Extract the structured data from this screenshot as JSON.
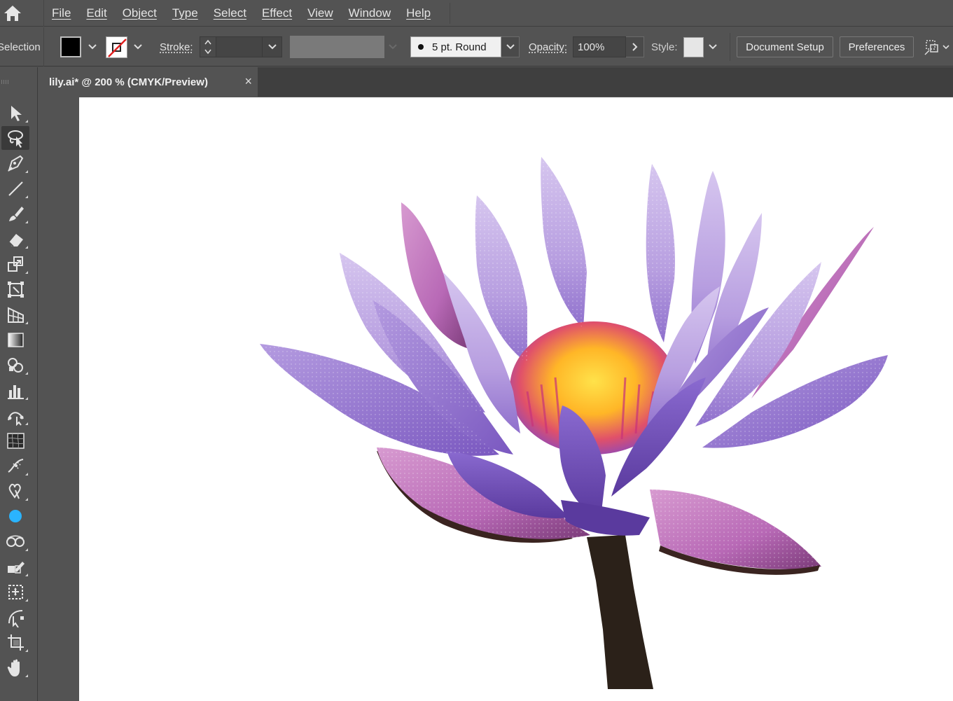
{
  "menu": {
    "items": [
      "File",
      "Edit",
      "Object",
      "Type",
      "Select",
      "Effect",
      "View",
      "Window",
      "Help"
    ]
  },
  "control_bar": {
    "mode_label": "Selection",
    "fill_color": "#000000",
    "stroke_label": "Stroke:",
    "brush_label": "5 pt. Round",
    "opacity_label": "Opacity:",
    "opacity_value": "100%",
    "style_label": "Style:",
    "document_setup": "Document Setup",
    "preferences": "Preferences"
  },
  "document_tab": {
    "title": "lily.ai* @ 200 % (CMYK/Preview)",
    "close": "×"
  },
  "toolbar": {
    "tools": [
      "selection-tool-icon",
      "lasso-tool-icon",
      "pen-tool-icon",
      "line-tool-icon",
      "paintbrush-tool-icon",
      "eraser-tool-icon",
      "scale-tool-icon",
      "free-transform-tool-icon",
      "perspective-grid-tool-icon",
      "gradient-tool-icon",
      "shape-builder-tool-icon",
      "column-graph-tool-icon",
      "curvature-tool-icon",
      "mesh-tool-icon",
      "width-tool-icon",
      "symbol-sprayer-tool-icon",
      "color-circle-icon",
      "blend-tool-icon",
      "live-paint-tool-icon",
      "artboard-tool-icon",
      "rotate-view-tool-icon",
      "crop-tool-icon",
      "hand-tool-icon"
    ],
    "active_tool": "lasso-tool-icon"
  },
  "colors": {
    "ui_background": "#535353",
    "tab_strip": "#3f3f3f",
    "accent_blue": "#2ab4ff",
    "petal_light": "#c7b3e6",
    "petal_mid": "#9b7fd4",
    "petal_dark": "#6a49b0",
    "petal_pink": "#c566b8",
    "stamen_yellow": "#ffc629",
    "stamen_red": "#d8435a",
    "stem": "#2b2119"
  }
}
